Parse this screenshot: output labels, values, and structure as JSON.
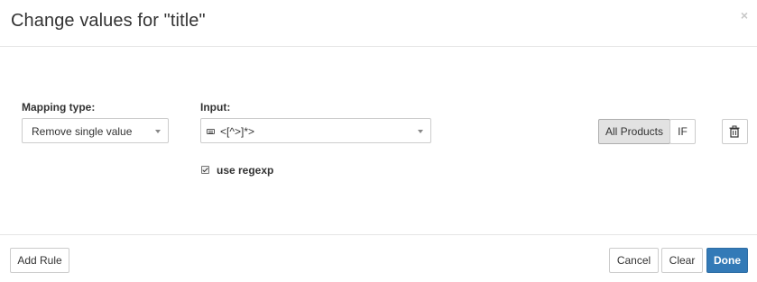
{
  "dialog": {
    "title": "Change values for \"title\"",
    "close_symbol": "×"
  },
  "rule": {
    "mapping_type_label": "Mapping type:",
    "mapping_type_value": "Remove single value",
    "input_label": "Input:",
    "input_value": "<[^>]*>",
    "input_icon": "keyboard-icon",
    "use_regexp_label": "use regexp",
    "use_regexp_checked": true,
    "scope_all_products_label": "All Products",
    "scope_if_label": "IF",
    "scope_selected": "All Products",
    "delete_icon": "trash-icon"
  },
  "footer": {
    "add_rule_label": "Add Rule",
    "cancel_label": "Cancel",
    "clear_label": "Clear",
    "done_label": "Done"
  },
  "colors": {
    "primary": "#337ab7",
    "active_toggle": "#e2e2e2",
    "border": "#cccccc"
  }
}
